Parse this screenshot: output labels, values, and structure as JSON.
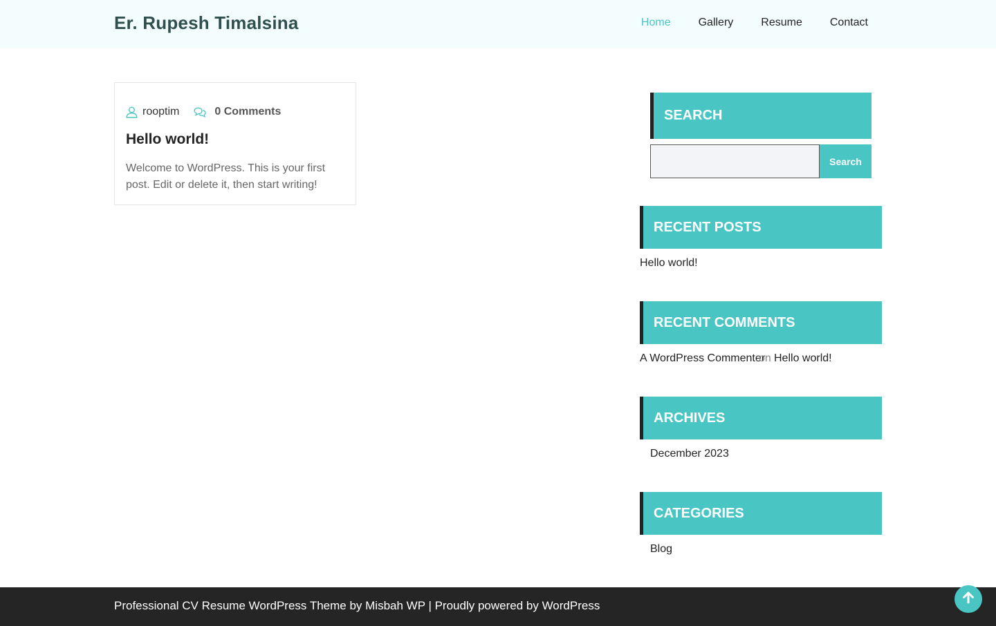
{
  "header": {
    "site_title": "Er. Rupesh Timalsina",
    "nav": [
      "Home",
      "Gallery",
      "Resume",
      "Contact"
    ],
    "active_nav": "Home"
  },
  "post": {
    "author": "rooptim",
    "comments": "0 Comments",
    "title": "Hello world!",
    "excerpt": "Welcome to WordPress. This is your first post. Edit or delete it, then start writing!"
  },
  "sidebar": {
    "search": {
      "title": "SEARCH",
      "button": "Search",
      "value": ""
    },
    "recent_posts": {
      "title": "RECENT POSTS",
      "items": [
        "Hello world!"
      ]
    },
    "recent_comments": {
      "title": "RECENT COMMENTS",
      "author": "A WordPress Commenter",
      "joiner": "on",
      "post": "Hello world!"
    },
    "archives": {
      "title": "ARCHIVES",
      "items": [
        "December 2023"
      ]
    },
    "categories": {
      "title": "CATEGORIES",
      "items": [
        "Blog"
      ]
    }
  },
  "footer": {
    "text": "Professional CV Resume WordPress Theme by Misbah WP | Proudly powered by WordPress"
  },
  "colors": {
    "accent": "#49c6c4",
    "header_bg": "#f3fdfd",
    "footer_bg": "#252525",
    "title": "#2f4f4f"
  },
  "icons": {
    "author": "user-icon",
    "comments": "comments-icon",
    "to_top": "arrow-up-icon"
  }
}
